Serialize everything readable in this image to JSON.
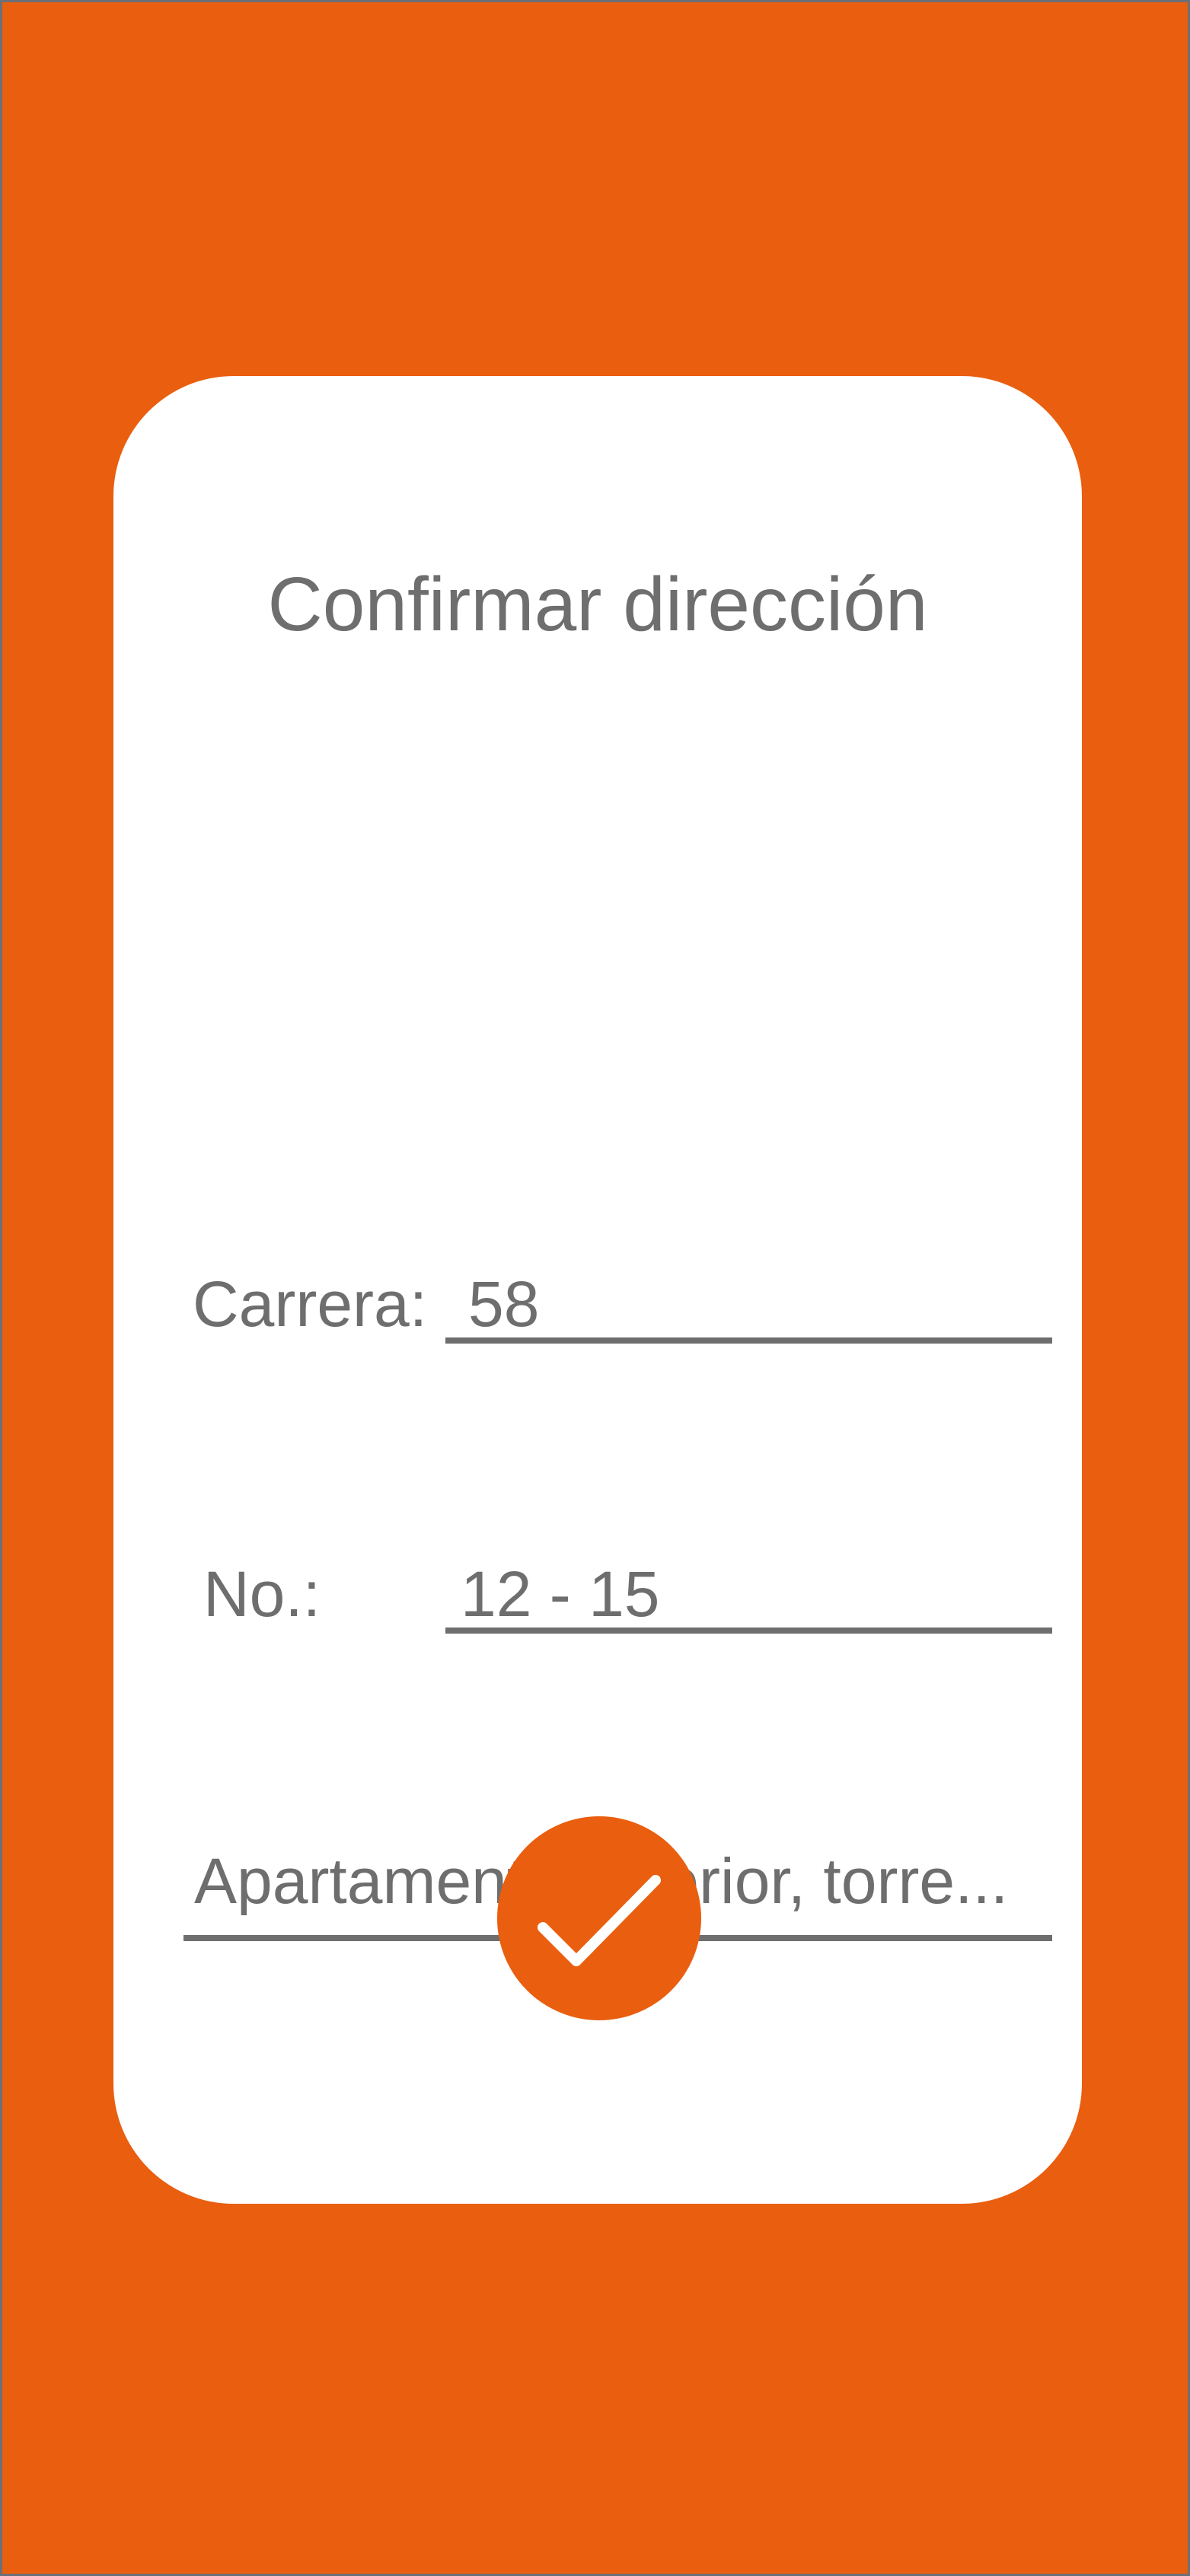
{
  "dialog": {
    "title": "Confirmar dirección",
    "fields": {
      "carrera": {
        "label": "Carrera:",
        "value": "58"
      },
      "numero": {
        "label": "No.:",
        "value": "12 - 15"
      },
      "detalle": {
        "value": "",
        "placeholder": "Apartamento, interior, torre..."
      }
    },
    "confirm_button": {
      "icon": "checkmark-icon"
    }
  },
  "colors": {
    "background": "#e95e0f",
    "card": "#ffffff",
    "text": "#6e6e6e",
    "accent": "#e95e0f",
    "frame_border": "#6b6f77"
  }
}
